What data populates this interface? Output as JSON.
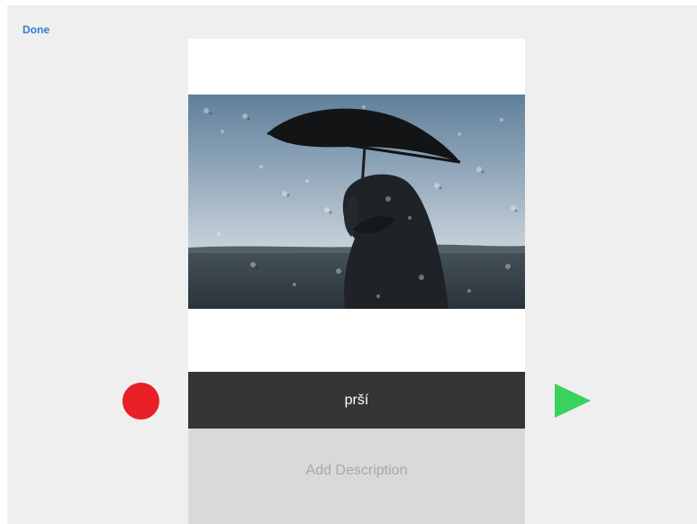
{
  "toolbar": {
    "done_label": "Done"
  },
  "card": {
    "image_icon": "photo-rain-umbrella",
    "word": "prší",
    "description_placeholder": "Add Description"
  },
  "controls": {
    "record_icon": "record-icon",
    "play_icon": "play-icon",
    "record_color": "#e81f25",
    "play_color": "#38d35c"
  }
}
